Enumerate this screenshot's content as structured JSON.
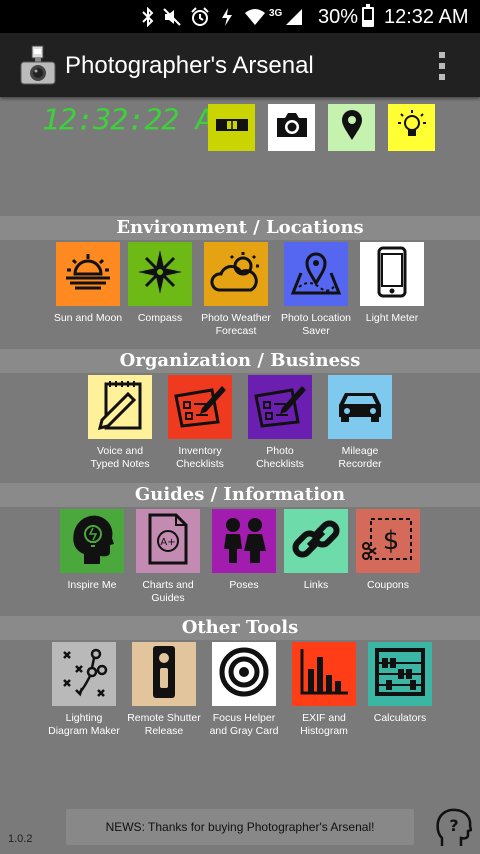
{
  "status_bar": {
    "battery_percent": "30%",
    "battery_level": 0.3,
    "time": "12:32 AM",
    "network_type": "3G",
    "icons": [
      "bluetooth-icon",
      "mute-icon",
      "alarm-icon",
      "data-icon",
      "wifi-icon",
      "signal-icon",
      "battery-icon"
    ]
  },
  "app_bar": {
    "title": "Photographer's Arsenal",
    "icon": "camera-flash-icon",
    "menu_icon": "overflow-menu-icon"
  },
  "top_row": {
    "clock": "12:32:22 AM",
    "quick_tools": [
      {
        "icon": "level-icon",
        "color": "#c9d400"
      },
      {
        "icon": "camera-icon",
        "color": "#ffffff"
      },
      {
        "icon": "location-pin-icon",
        "color": "#c6f2b0"
      },
      {
        "icon": "light-bulb-icon",
        "color": "#ffff33"
      }
    ]
  },
  "sections": [
    {
      "title": "Environment / Locations",
      "tools": [
        {
          "label": "Sun and Moon",
          "icon": "sunrise-icon",
          "color": "#ff8a22"
        },
        {
          "label": "Compass",
          "icon": "compass-icon",
          "color": "#6dba16"
        },
        {
          "label": "Photo Weather Forecast",
          "icon": "weather-icon",
          "color": "#e5a313"
        },
        {
          "label": "Photo Location Saver",
          "icon": "map-location-icon",
          "color": "#5566f0"
        },
        {
          "label": "Light Meter",
          "icon": "phone-icon",
          "color": "#ffffff"
        }
      ]
    },
    {
      "title": "Organization / Business",
      "tools": [
        {
          "label": "Voice and Typed Notes",
          "icon": "notepad-icon",
          "color": "#fff09a"
        },
        {
          "label": "Inventory Checklists",
          "icon": "checklist-icon",
          "color": "#f03a1f"
        },
        {
          "label": "Photo Checklists",
          "icon": "checklist-icon",
          "color": "#6a1fb0"
        },
        {
          "label": "Mileage Recorder",
          "icon": "car-icon",
          "color": "#7fc9ef"
        }
      ]
    },
    {
      "title": "Guides / Information",
      "tools": [
        {
          "label": "Inspire Me",
          "icon": "head-idea-icon",
          "color": "#4aa83c"
        },
        {
          "label": "Charts and Guides",
          "icon": "document-grade-icon",
          "color": "#c48bb2"
        },
        {
          "label": "Poses",
          "icon": "people-icon",
          "color": "#a21cb0"
        },
        {
          "label": "Links",
          "icon": "link-icon",
          "color": "#6ddcaa"
        },
        {
          "label": "Coupons",
          "icon": "coupon-icon",
          "color": "#d46a59"
        }
      ]
    },
    {
      "title": "Other Tools",
      "tools": [
        {
          "label": "Lighting Diagram Maker",
          "icon": "diagram-icon",
          "color": "#b9b9b9"
        },
        {
          "label": "Remote Shutter Release",
          "icon": "remote-icon",
          "color": "#e2c59c"
        },
        {
          "label": "Focus Helper and Gray Card",
          "icon": "target-icon",
          "color": "#ffffff"
        },
        {
          "label": "EXIF and Histogram",
          "icon": "histogram-icon",
          "color": "#ff3d17"
        },
        {
          "label": "Calculators",
          "icon": "abacus-icon",
          "color": "#3bb5a4"
        }
      ]
    }
  ],
  "footer": {
    "version": "1.0.2",
    "news": "NEWS: Thanks for buying Photographer's Arsenal!",
    "help_icon": "help-icon"
  }
}
